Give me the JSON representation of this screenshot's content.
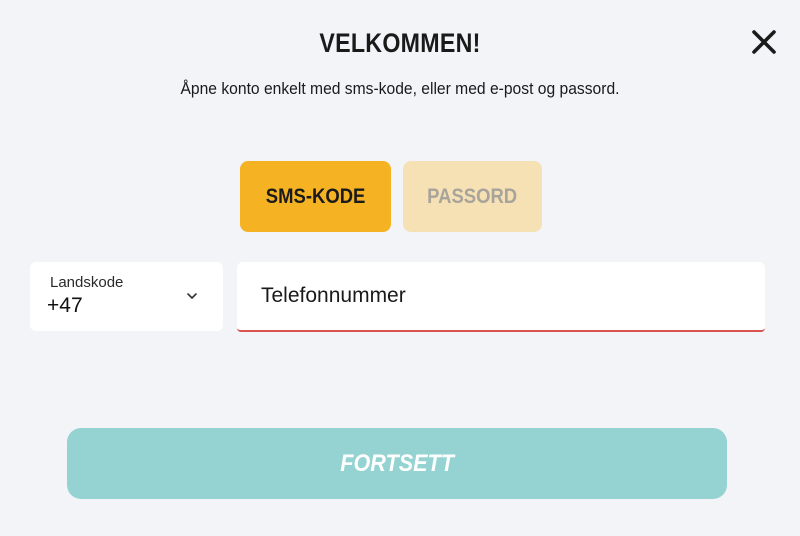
{
  "header": {
    "title": "VELKOMMEN!",
    "subtitle": "Åpne konto enkelt med sms-kode, eller med e-post og passord.",
    "close_icon": "close-icon"
  },
  "login_modes": {
    "tabs": [
      {
        "label": "SMS-KODE",
        "selected": true
      },
      {
        "label": "PASSORD",
        "selected": false
      }
    ]
  },
  "phone_form": {
    "country_label": "Landskode",
    "country_value": "+47",
    "dropdown_icon": "chevron-down-icon",
    "phone_placeholder": "Telefonnummer",
    "phone_value": ""
  },
  "submit": {
    "label": "FORTSETT"
  },
  "colors": {
    "background": "#f3f4f8",
    "tab_selected": "#f5b324",
    "tab_unselected": "#f6e1b5",
    "error_underline": "#d9534f",
    "submit_disabled": "#94d3d2"
  }
}
